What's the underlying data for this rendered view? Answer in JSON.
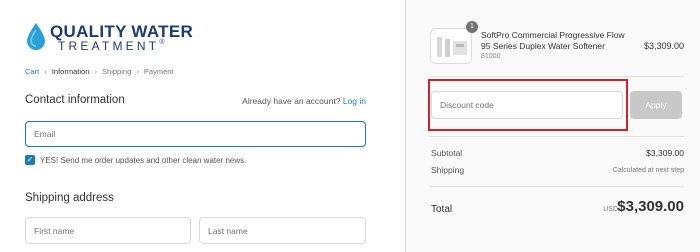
{
  "logo": {
    "line1": "QUALITY WATER",
    "line2": "TREATMENT",
    "mark": "®",
    "color": "#1f3b73"
  },
  "breadcrumb": [
    "Cart",
    "Information",
    "Shipping",
    "Payment"
  ],
  "contact": {
    "title": "Contact information",
    "login_prompt": "Already have an account?",
    "login_link": "Log in",
    "email_placeholder": "Email",
    "newsletter_label": "YES! Send me order updates and other clean water news."
  },
  "shipping": {
    "title": "Shipping address",
    "first_name_placeholder": "First name",
    "last_name_placeholder": "Last name"
  },
  "cart": {
    "quantity_badge": "1",
    "product_name": "SoftPro Commercial Progressive Flow 95 Series Duplex Water Softener",
    "product_sku": "81000",
    "product_price": "$3,309.00"
  },
  "discount": {
    "placeholder": "Discount code",
    "apply_label": "Apply"
  },
  "summary": {
    "subtotal_label": "Subtotal",
    "subtotal_value": "$3,309.00",
    "shipping_label": "Shipping",
    "shipping_value": "Calculated at next step",
    "total_label": "Total",
    "currency": "USD",
    "total_value": "$3,309.00"
  },
  "colors": {
    "accent": "#197bbd",
    "highlight": "#d6202a"
  }
}
